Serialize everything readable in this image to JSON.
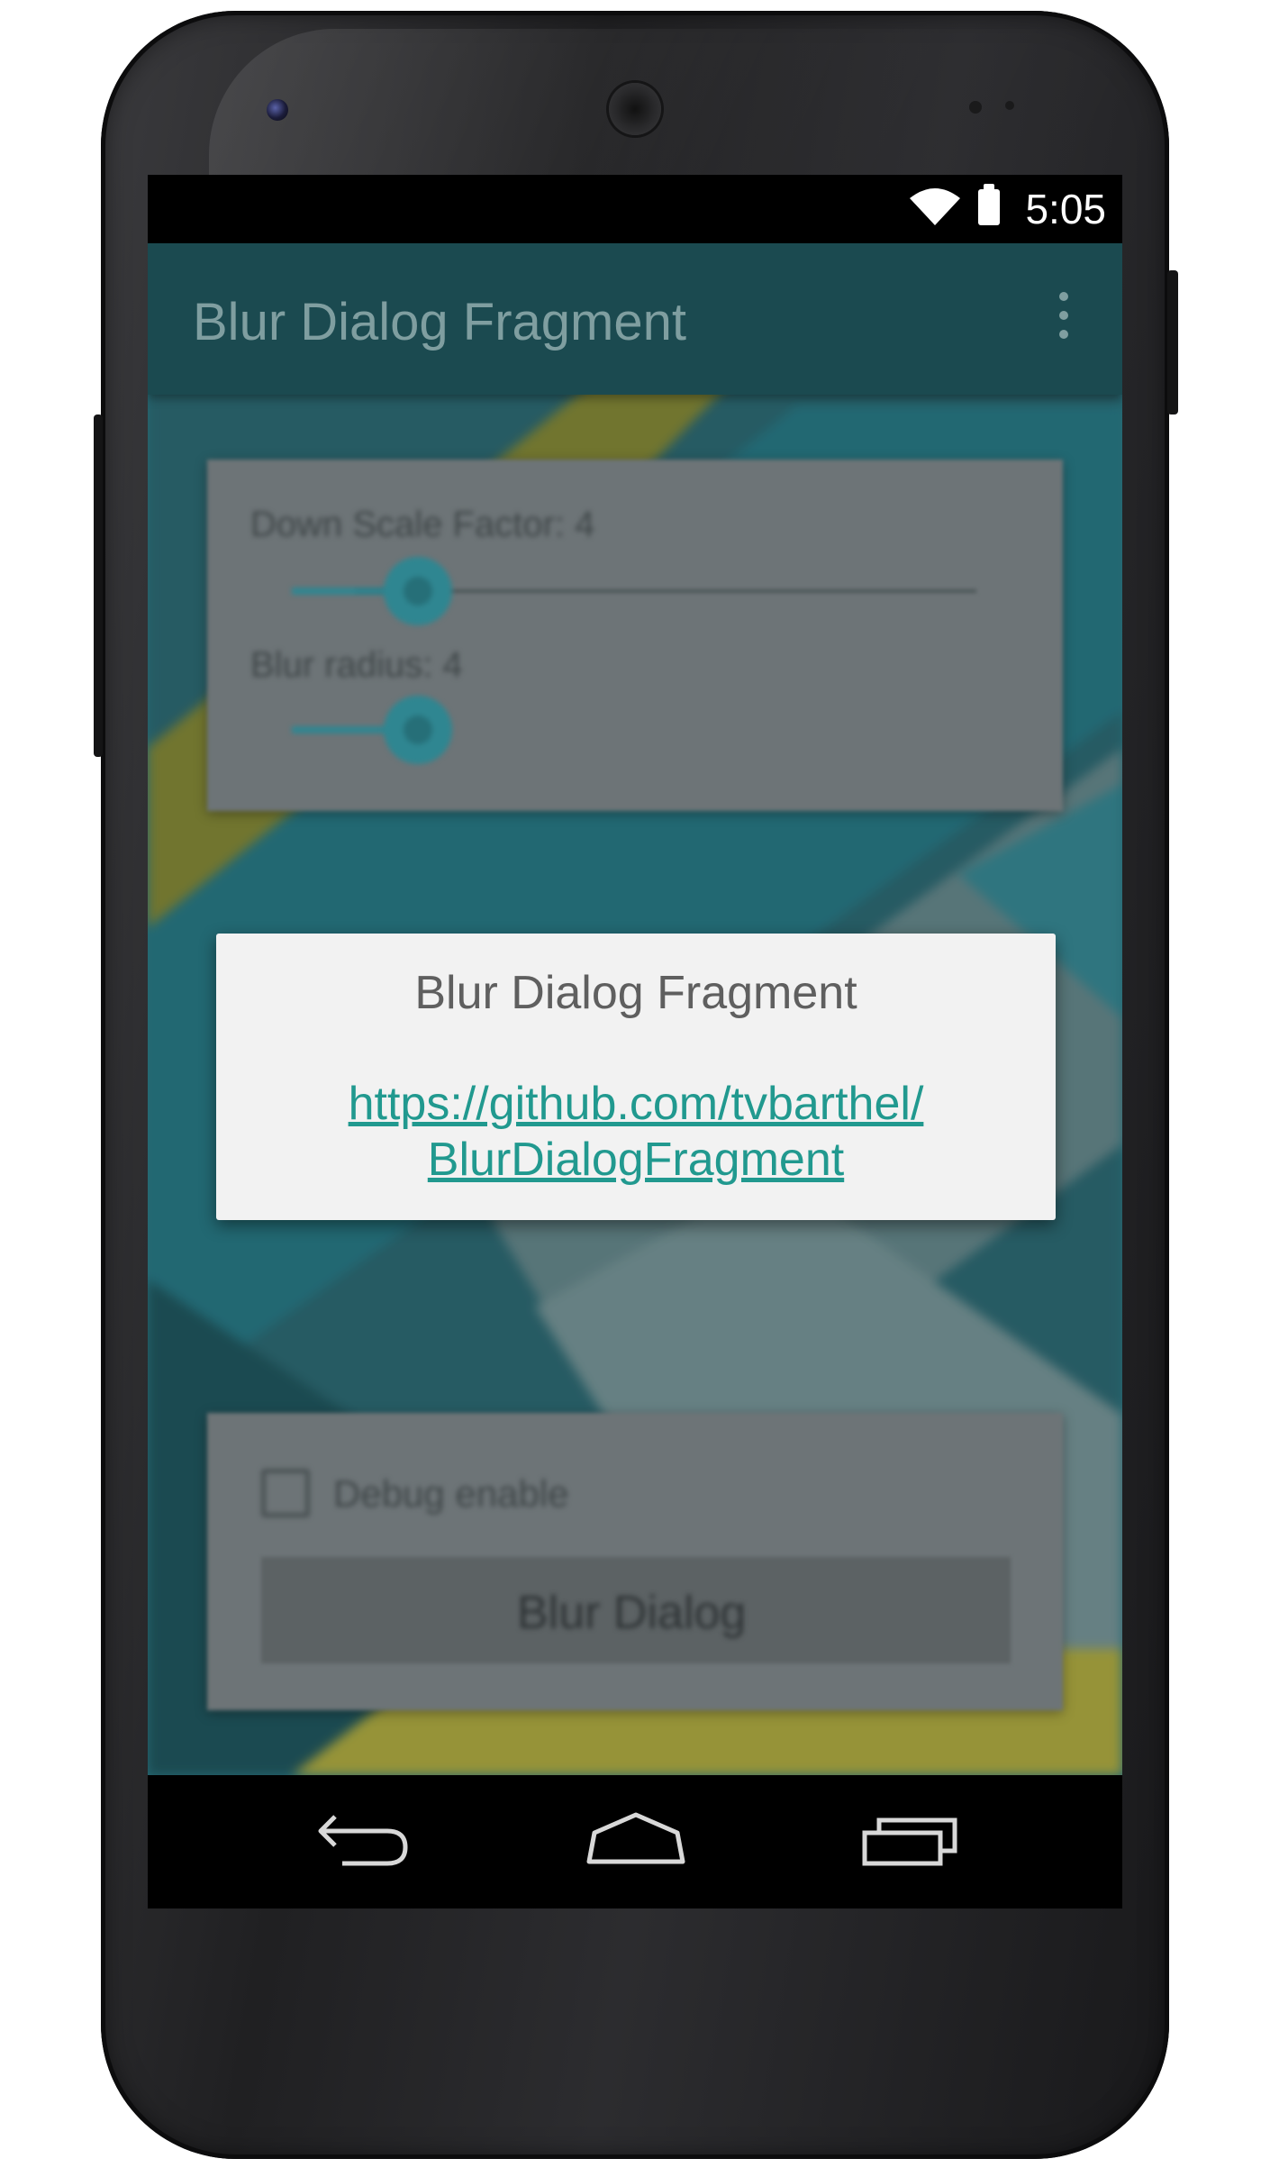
{
  "status_bar": {
    "time": "5:05",
    "icons": [
      "wifi-icon",
      "battery-icon"
    ]
  },
  "action_bar": {
    "title": "Blur Dialog Fragment",
    "overflow_icon": "overflow-menu-icon"
  },
  "background_settings": {
    "down_scale_label": "Down Scale Factor: 4",
    "blur_radius_label": "Blur radius: 4",
    "debug_checkbox_label": "Debug enable",
    "blur_button_label": "Blur Dialog"
  },
  "dialog": {
    "title": "Blur Dialog Fragment",
    "link_line1": "https://github.com/tvbarthel/",
    "link_line2": "BlurDialogFragment"
  },
  "navigation": {
    "back_icon": "back-icon",
    "home_icon": "home-icon",
    "recents_icon": "recents-icon"
  },
  "colors": {
    "action_bar": "#1b4a50",
    "accent": "#21998f",
    "dialog_background": "#f2f2f2"
  }
}
